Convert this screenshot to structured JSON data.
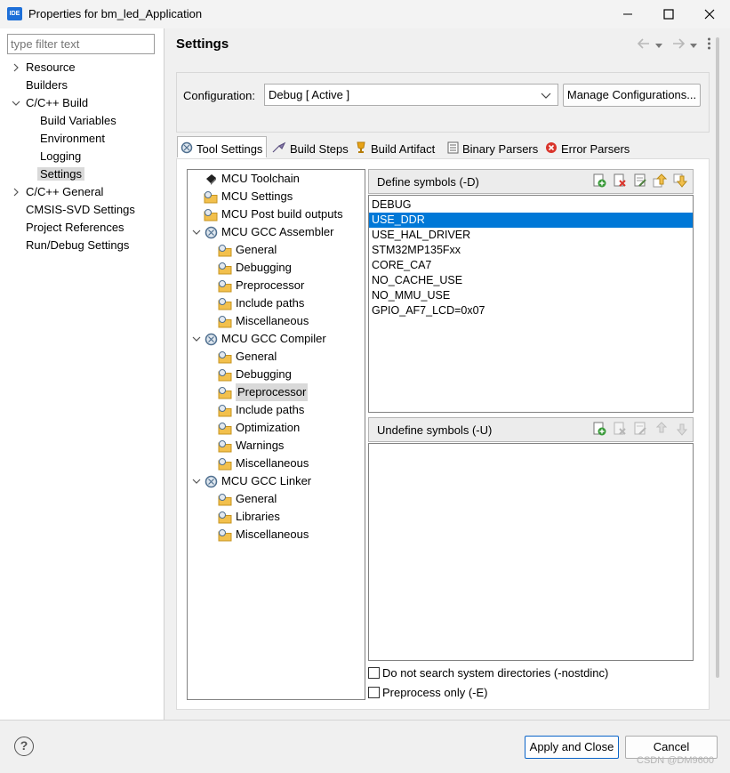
{
  "window": {
    "icon_text": "IDE",
    "title": "Properties for bm_led_Application"
  },
  "filter": {
    "placeholder": "type filter text"
  },
  "nav": {
    "resource": "Resource",
    "builders": "Builders",
    "cc_build": "C/C++ Build",
    "build_variables": "Build Variables",
    "environment": "Environment",
    "logging": "Logging",
    "settings": "Settings",
    "cc_general": "C/C++ General",
    "cmsis_svd": "CMSIS-SVD Settings",
    "project_references": "Project References",
    "run_debug": "Run/Debug Settings"
  },
  "page": {
    "title": "Settings"
  },
  "config": {
    "label": "Configuration:",
    "value": "Debug  [ Active ]",
    "manage_label": "Manage Configurations..."
  },
  "tabs": {
    "tool_settings": "Tool Settings",
    "build_steps": "Build Steps",
    "build_artifact": "Build Artifact",
    "binary_parsers": "Binary Parsers",
    "error_parsers": "Error Parsers"
  },
  "tree": {
    "toolchain": "MCU Toolchain",
    "settings": "MCU Settings",
    "post_build": "MCU Post build outputs",
    "assembler": "MCU GCC Assembler",
    "asm_general": "General",
    "asm_debugging": "Debugging",
    "asm_preprocessor": "Preprocessor",
    "asm_include": "Include paths",
    "asm_misc": "Miscellaneous",
    "compiler": "MCU GCC Compiler",
    "cc_general": "General",
    "cc_debugging": "Debugging",
    "cc_preprocessor": "Preprocessor",
    "cc_include": "Include paths",
    "cc_optimization": "Optimization",
    "cc_warnings": "Warnings",
    "cc_misc": "Miscellaneous",
    "linker": "MCU GCC Linker",
    "ld_general": "General",
    "ld_libraries": "Libraries",
    "ld_misc": "Miscellaneous"
  },
  "define": {
    "header": "Define symbols (-D)",
    "symbols": [
      "DEBUG",
      "USE_DDR",
      "USE_HAL_DRIVER",
      "STM32MP135Fxx",
      "CORE_CA7",
      "NO_CACHE_USE",
      "NO_MMU_USE",
      "GPIO_AF7_LCD=0x07"
    ],
    "selected_index": 1
  },
  "undefine": {
    "header": "Undefine symbols (-U)"
  },
  "options": {
    "nostdinc": "Do not search system directories (-nostdinc)",
    "preprocess_only": "Preprocess only (-E)"
  },
  "footer": {
    "help": "?",
    "apply_close": "Apply and Close",
    "cancel": "Cancel"
  },
  "watermark": "CSDN @DM9600",
  "colors": {
    "selection": "#0078d7",
    "folder": "#f2c04d",
    "gear": "#4f6f8f",
    "error_icon": "#d9342b",
    "trophy": "#e8a317"
  }
}
